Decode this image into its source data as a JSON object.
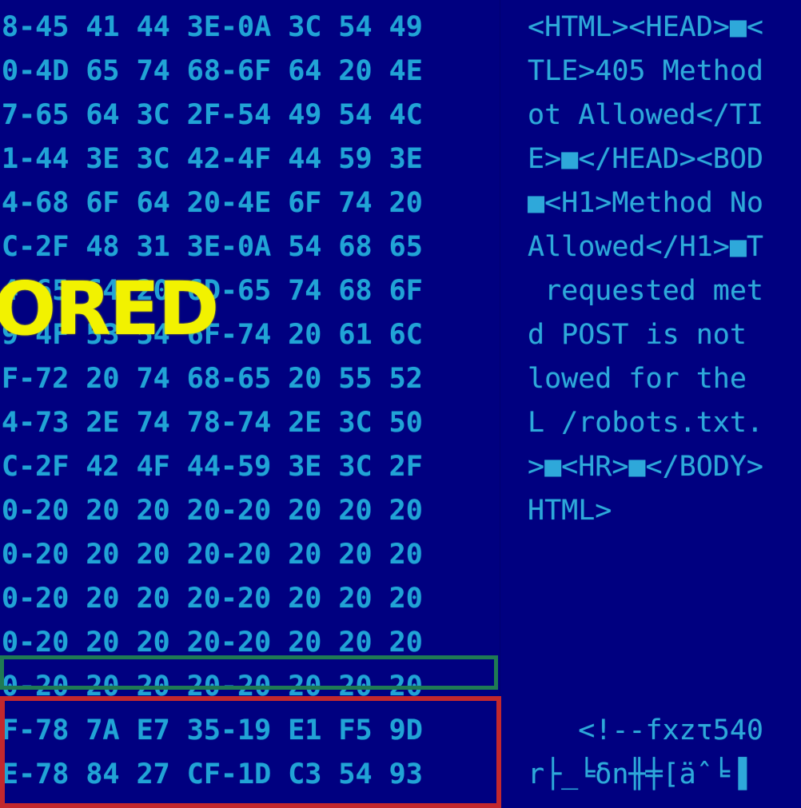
{
  "overlay": {
    "label": "ORED",
    "color": "#f2f200"
  },
  "colors": {
    "background": "#000080",
    "hex_text": "#21a3d6",
    "green_highlight": "#1f7a54",
    "red_highlight": "#c2282d"
  },
  "hex_rows": [
    "8-45 41 44 3E-0A 3C 54 49",
    "0-4D 65 74 68-6F 64 20 4E",
    "7-65 64 3C 2F-54 49 54 4C",
    "1-44 3E 3C 42-4F 44 59 3E",
    "4-68 6F 64 20-4E 6F 74 20",
    "C-2F 48 31 3E-0A 54 68 65",
    "4 65 64 20 6D-65 74 68 6F",
    "9 4F 53 54 6F-74 20 61 6C",
    "F-72 20 74 68-65 20 55 52",
    "4-73 2E 74 78-74 2E 3C 50",
    "C-2F 42 4F 44-59 3E 3C 2F",
    "0-20 20 20 20-20 20 20 20",
    "0-20 20 20 20-20 20 20 20",
    "0-20 20 20 20-20 20 20 20",
    "0-20 20 20 20-20 20 20 20",
    "0-20 20 20 20-20 20 20 20",
    "F-78 7A E7 35-19 E1 F5 9D",
    "E-78 84 27 CF-1D C3 54 93"
  ],
  "ascii_rows": [
    "<HTML><HEAD>■<",
    "TLE>405 Method",
    "ot Allowed</TI",
    "E>■</HEAD><BOD",
    "■<H1>Method No",
    "Allowed</H1>■T",
    " requested met",
    "d POST is not ",
    "lowed for the ",
    "L /robots.txt.",
    ">■<HR>■</BODY>",
    "HTML>",
    "",
    "",
    "",
    "",
    "   <!--fxzτ540",
    "r├_╘δn╫╪[äˆ╘▐"
  ]
}
